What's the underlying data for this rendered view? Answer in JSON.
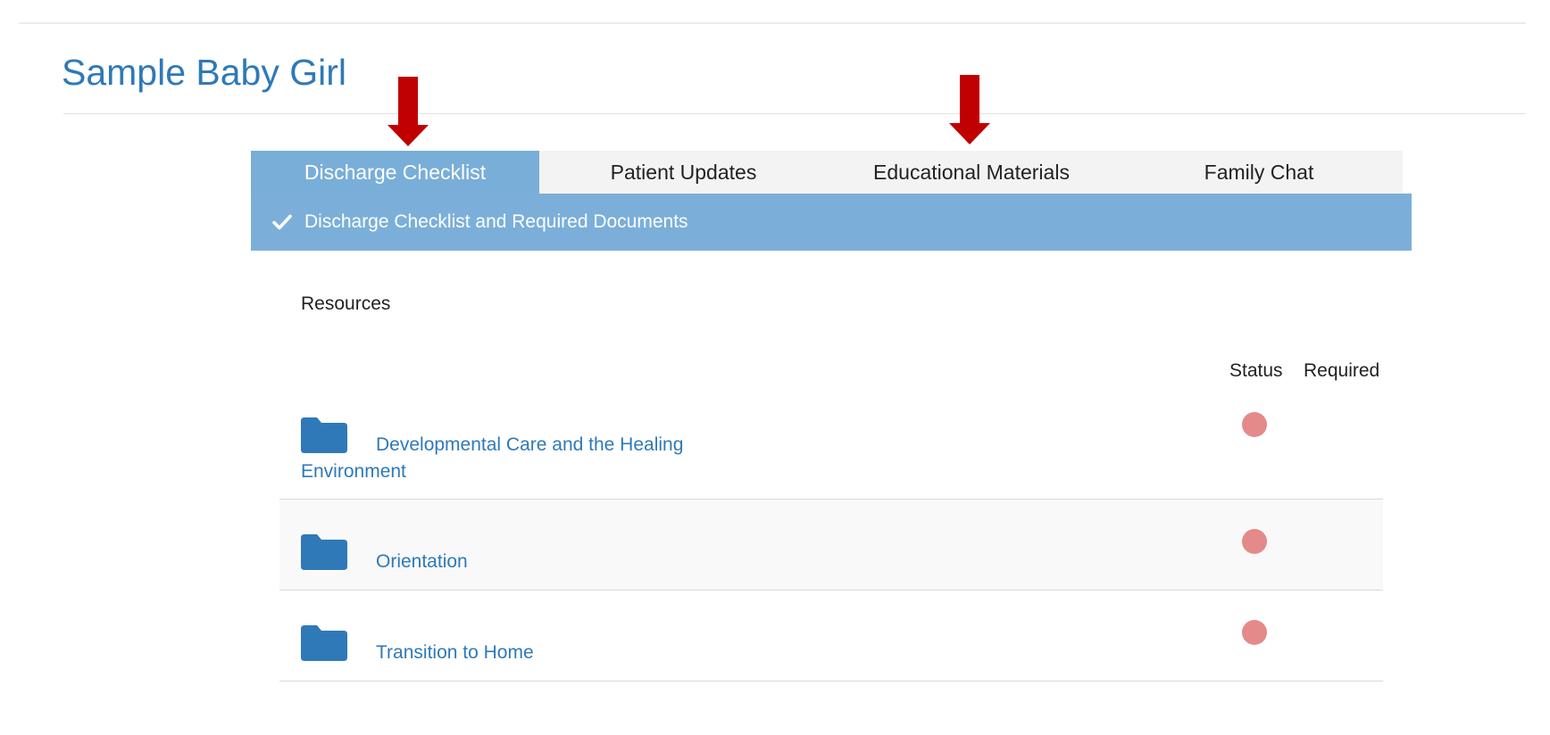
{
  "page": {
    "title": "Sample Baby Girl"
  },
  "tabs": [
    {
      "label": "Discharge Checklist",
      "active": true
    },
    {
      "label": "Patient Updates",
      "active": false
    },
    {
      "label": "Educational Materials",
      "active": false
    },
    {
      "label": "Family Chat",
      "active": false
    }
  ],
  "section": {
    "title": "Discharge Checklist and Required Documents",
    "icon": "check-icon"
  },
  "resources": {
    "label": "Resources",
    "columns": {
      "status": "Status",
      "required": "Required"
    },
    "items": [
      {
        "title": "Developmental Care and the Healing Environment",
        "icon": "folder-icon",
        "status_color": "#e48a8a"
      },
      {
        "title": "Orientation",
        "icon": "folder-icon",
        "status_color": "#e48a8a"
      },
      {
        "title": "Transition to Home",
        "icon": "folder-icon",
        "status_color": "#e48a8a"
      }
    ]
  },
  "annotations": {
    "arrow_icon": "down-arrow-icon",
    "arrow_color": "#c00000"
  },
  "colors": {
    "brand_blue": "#2f79b8",
    "active_tab": "#79aed8",
    "section_header": "#7bafd9",
    "tab_bar": "#f3f3f3"
  }
}
